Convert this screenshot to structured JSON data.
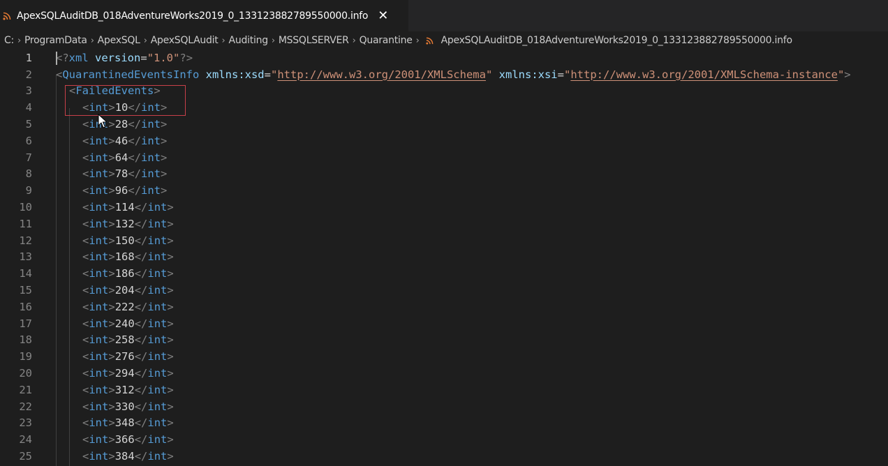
{
  "tab": {
    "title": "ApexSQLAuditDB_018AdventureWorks2019_0_133123882789550000.info",
    "close_glyph": "✕",
    "icon": "rss-icon",
    "icon_color": "#e37933"
  },
  "breadcrumb": {
    "items": [
      "C:",
      "ProgramData",
      "ApexSQL",
      "ApexSQLAudit",
      "Auditing",
      "MSSQLSERVER",
      "Quarantine"
    ],
    "file": "ApexSQLAuditDB_018AdventureWorks2019_0_133123882789550000.info",
    "separator": "›"
  },
  "editor": {
    "line_numbers": [
      "1",
      "2",
      "3",
      "4",
      "5",
      "6",
      "7",
      "8",
      "9",
      "10",
      "11",
      "12",
      "13",
      "14",
      "15",
      "16",
      "17",
      "18",
      "19",
      "20",
      "21",
      "22",
      "23",
      "24",
      "25"
    ],
    "line1": {
      "open": "<?",
      "name": "xml",
      "attr": "version",
      "eq": "=",
      "value": "\"1.0\"",
      "close": "?>"
    },
    "line2": {
      "open": "<",
      "tag": "QuarantinedEventsInfo",
      "attr1": "xmlns:xsd",
      "eq": "=",
      "q": "\"",
      "url1": "http://www.w3.org/2001/XMLSchema",
      "attr2": "xmlns:xsi",
      "url2": "http://www.w3.org/2001/XMLSchema-instance",
      "close": ">"
    },
    "line3": {
      "open": "<",
      "tag": "FailedEvents",
      "close": ">"
    },
    "int_tag": "int",
    "int_values": [
      "10",
      "28",
      "46",
      "64",
      "78",
      "96",
      "114",
      "132",
      "150",
      "168",
      "186",
      "204",
      "222",
      "240",
      "258",
      "276",
      "294",
      "312",
      "330",
      "348",
      "366",
      "384"
    ]
  },
  "colors": {
    "background": "#1e1e1e",
    "tag": "#569cd6",
    "attribute": "#9cdcfe",
    "string": "#ce9178",
    "punctuation": "#808080",
    "highlight_box": "#c8404a"
  }
}
